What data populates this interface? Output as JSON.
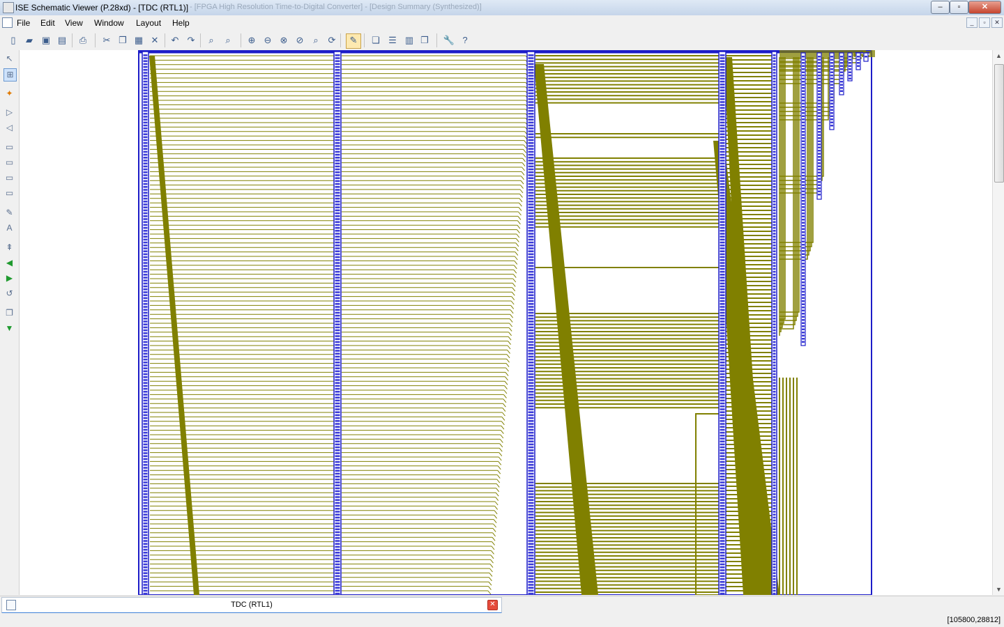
{
  "window": {
    "title": "ISE Schematic Viewer (P.28xd) - [TDC (RTL1)]",
    "title_suffix_blurred": "- [FPGA High Resolution Time-to-Digital Converter] - [Design Summary (Synthesized)]",
    "minimize_label": "–",
    "maximize_label": "▫",
    "close_label": "✕"
  },
  "menu": {
    "items": [
      "File",
      "Edit",
      "View",
      "Window",
      "Layout",
      "Help"
    ],
    "mdi_minimize": "_",
    "mdi_restore": "▫",
    "mdi_close": "✕"
  },
  "toolbar": {
    "buttons": [
      {
        "name": "new-icon",
        "glyph": "▯"
      },
      {
        "name": "open-icon",
        "glyph": "▰"
      },
      {
        "name": "save-icon",
        "glyph": "▣"
      },
      {
        "name": "save-all-icon",
        "glyph": "▤"
      },
      {
        "name": "print-icon",
        "glyph": "⎙"
      },
      {
        "name": "cut-icon",
        "glyph": "✂"
      },
      {
        "name": "copy-icon",
        "glyph": "❐"
      },
      {
        "name": "paste-icon",
        "glyph": "▦"
      },
      {
        "name": "delete-icon",
        "glyph": "✕"
      },
      {
        "name": "undo-icon",
        "glyph": "↶"
      },
      {
        "name": "redo-icon",
        "glyph": "↷"
      },
      {
        "name": "find-icon",
        "glyph": "⌕"
      },
      {
        "name": "find-next-icon",
        "glyph": "⌕"
      },
      {
        "name": "zoom-in-icon",
        "glyph": "⊕"
      },
      {
        "name": "zoom-out-icon",
        "glyph": "⊖"
      },
      {
        "name": "zoom-full-icon",
        "glyph": "⊗"
      },
      {
        "name": "zoom-box-icon",
        "glyph": "⊘"
      },
      {
        "name": "zoom-selection-icon",
        "glyph": "⌕"
      },
      {
        "name": "refresh-icon",
        "glyph": "⟳"
      },
      {
        "name": "pan-icon",
        "glyph": "✎"
      },
      {
        "name": "cascade-icon",
        "glyph": "❏"
      },
      {
        "name": "tile-horizontal-icon",
        "glyph": "☰"
      },
      {
        "name": "tile-vertical-icon",
        "glyph": "▥"
      },
      {
        "name": "arrange-icon",
        "glyph": "❐"
      },
      {
        "name": "settings-icon",
        "glyph": "🔧"
      },
      {
        "name": "help-icon",
        "glyph": "?"
      }
    ]
  },
  "left_tools": [
    {
      "name": "select-tool-icon",
      "glyph": "↖"
    },
    {
      "name": "schematic-view-icon",
      "glyph": "⊞"
    },
    {
      "name": "add-instance-icon",
      "glyph": "✦"
    },
    {
      "name": "expand-input-icon",
      "glyph": "▷"
    },
    {
      "name": "expand-output-icon",
      "glyph": "◁"
    },
    {
      "name": "show-block-icon",
      "glyph": "▭"
    },
    {
      "name": "hide-block-icon",
      "glyph": "▭"
    },
    {
      "name": "remove-icon",
      "glyph": "▭"
    },
    {
      "name": "properties-icon",
      "glyph": "▭"
    },
    {
      "name": "edit-icon",
      "glyph": "✎"
    },
    {
      "name": "label-icon",
      "glyph": "A"
    },
    {
      "name": "push-icon",
      "glyph": "⇞"
    },
    {
      "name": "back-icon",
      "glyph": "◀"
    },
    {
      "name": "forward-icon",
      "glyph": "▶"
    },
    {
      "name": "history-icon",
      "glyph": "↺"
    },
    {
      "name": "copy-view-icon",
      "glyph": "❐"
    },
    {
      "name": "export-icon",
      "glyph": "▼"
    }
  ],
  "colors": {
    "wire": "#808000",
    "instance": "#1c1cc8",
    "canvas": "#ffffff"
  },
  "tab": {
    "label": "TDC (RTL1)",
    "close_label": "✕"
  },
  "status": {
    "coords": "[105800,28812]"
  }
}
